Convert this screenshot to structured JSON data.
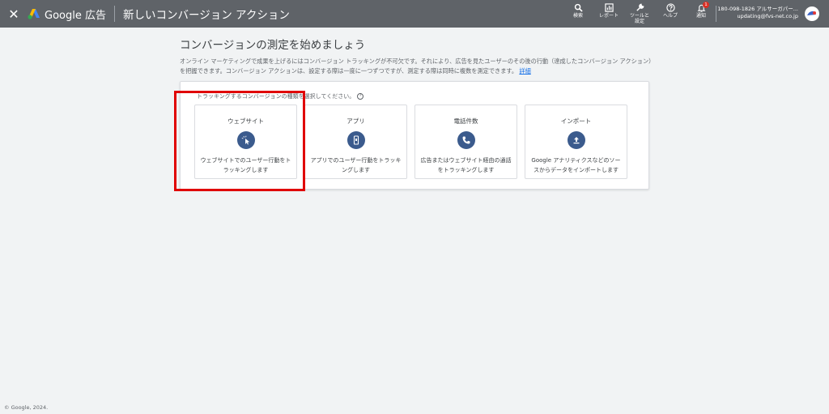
{
  "header": {
    "brand": "Google 広告",
    "page_title": "新しいコンバージョン アクション",
    "tools": [
      {
        "icon": "search-icon",
        "label": "検索"
      },
      {
        "icon": "report-icon",
        "label": "レポート"
      },
      {
        "icon": "wrench-icon",
        "label": "ツールと\n設定"
      },
      {
        "icon": "help-icon",
        "label": "ヘルプ"
      },
      {
        "icon": "bell-icon",
        "label": "通知",
        "badge": "1"
      }
    ],
    "account": {
      "id_name": "180-098-1826 アルサーガパー...",
      "email": "updating@fvs-net.co.jp"
    }
  },
  "main": {
    "heading": "コンバージョンの測定を始めましょう",
    "intro": "オンライン マーケティングで成果を上げるにはコンバージョン トラッキングが不可欠です。それにより、広告を見たユーザーのその後の行動（達成したコンバージョン アクション）を把握できます。コンバージョン アクションは、設定する際は一度に一つずつですが、測定する際は同時に複数を測定できます。",
    "details_link": "詳細",
    "instruction": "トラッキングするコンバージョンの種類を選択してください。",
    "help_mark": "?",
    "cards": [
      {
        "title": "ウェブサイト",
        "icon": "cursor-click-icon",
        "description": "ウェブサイトでのユーザー行動をトラッキングします"
      },
      {
        "title": "アプリ",
        "icon": "smartphone-icon",
        "description": "アプリでのユーザー行動をトラッキングします"
      },
      {
        "title": "電話件数",
        "icon": "phone-icon",
        "description": "広告またはウェブサイト経由の通話をトラッキングします"
      },
      {
        "title": "インポート",
        "icon": "upload-icon",
        "description": "Google アナリティクスなどのソースからデータをインポートします"
      }
    ]
  },
  "footer": {
    "copyright": "© Google, 2024."
  },
  "colors": {
    "topbar": "#5f6368",
    "icon_circle": "#3b5b8d",
    "highlight": "#e00000",
    "link": "#1a73e8"
  }
}
